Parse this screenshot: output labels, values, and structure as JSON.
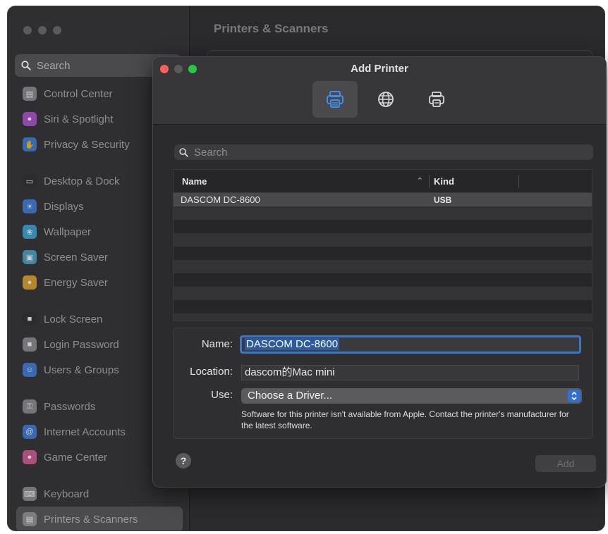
{
  "window": {
    "title": "Printers & Scanners"
  },
  "sidebar": {
    "search_placeholder": "Search",
    "items": [
      {
        "label": "Control Center",
        "icon": "control-center-icon",
        "color": "#8e8e93"
      },
      {
        "label": "Siri & Spotlight",
        "icon": "siri-icon",
        "color": "#b04fd6"
      },
      {
        "label": "Privacy & Security",
        "icon": "hand-icon",
        "color": "#3b7ddd"
      },
      {
        "label": "Desktop & Dock",
        "icon": "dock-icon",
        "color": "#2c2c2e"
      },
      {
        "label": "Displays",
        "icon": "sun-icon",
        "color": "#3b7ddd"
      },
      {
        "label": "Wallpaper",
        "icon": "flower-icon",
        "color": "#38a6d9"
      },
      {
        "label": "Screen Saver",
        "icon": "screen-saver-icon",
        "color": "#4aa3c8"
      },
      {
        "label": "Energy Saver",
        "icon": "bulb-icon",
        "color": "#e5a52a"
      },
      {
        "label": "Lock Screen",
        "icon": "lock-icon",
        "color": "#2c2c2e"
      },
      {
        "label": "Login Password",
        "icon": "padlock-icon",
        "color": "#8e8e93"
      },
      {
        "label": "Users & Groups",
        "icon": "users-icon",
        "color": "#3b7ddd"
      },
      {
        "label": "Passwords",
        "icon": "key-icon",
        "color": "#8e8e93"
      },
      {
        "label": "Internet Accounts",
        "icon": "at-icon",
        "color": "#3b7ddd"
      },
      {
        "label": "Game Center",
        "icon": "game-center-icon",
        "color": "#d65a9a"
      },
      {
        "label": "Keyboard",
        "icon": "keyboard-icon",
        "color": "#8e8e93"
      },
      {
        "label": "Printers & Scanners",
        "icon": "printer-icon",
        "color": "#8e8e93",
        "selected": true
      }
    ]
  },
  "dialog": {
    "title": "Add Printer",
    "toolbar": [
      {
        "name": "default-printers",
        "icon": "printer-icon",
        "active": true
      },
      {
        "name": "ip-printers",
        "icon": "globe-icon",
        "active": false
      },
      {
        "name": "windows-printers",
        "icon": "windows-printer-icon",
        "active": false
      }
    ],
    "search_placeholder": "Search",
    "table": {
      "columns": [
        "Name",
        "Kind"
      ],
      "rows": [
        {
          "name": "DASCOM DC-8600",
          "kind": "USB",
          "selected": true
        }
      ]
    },
    "name_label": "Name:",
    "name_value": "DASCOM DC-8600",
    "location_label": "Location:",
    "location_value": "dascom的Mac mini",
    "use_label": "Use:",
    "use_value": "Choose a Driver...",
    "note": "Software for this printer isn't available from Apple. Contact the printer's manufacturer for the latest software.",
    "help_label": "?",
    "add_label": "Add"
  },
  "colors": {
    "accent": "#2f6fd6",
    "close": "#ff5f57",
    "minimize": "#5b5b5e",
    "zoom": "#28c840"
  }
}
